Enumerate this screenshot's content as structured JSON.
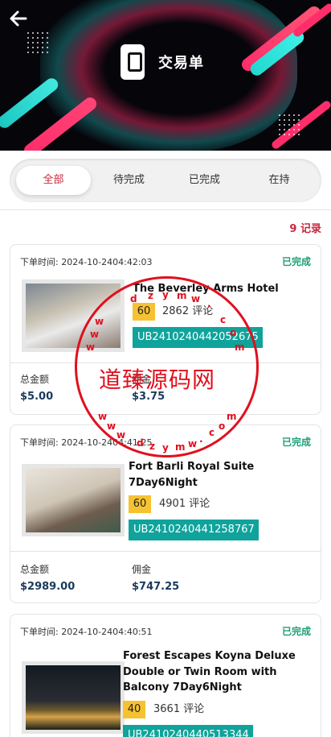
{
  "header": {
    "title": "交易单",
    "back_icon": "arrow-left-icon",
    "title_icon": "phone-icon"
  },
  "tabs": [
    {
      "label": "全部",
      "active": true
    },
    {
      "label": "待完成",
      "active": false
    },
    {
      "label": "已完成",
      "active": false
    },
    {
      "label": "在持",
      "active": false
    }
  ],
  "count_label": "9 记录",
  "orders": [
    {
      "time": "下单时间: 2024-10-2404:42:03",
      "status": "已完成",
      "name_line1": "The Beverley Arms Hotel",
      "name_line2": "",
      "name_line3": "",
      "rating": "60",
      "reviews": "2862 评论",
      "code": "UB2410240442052675",
      "total_label": "总金额",
      "total": "$5.00",
      "commission_label": "佣金",
      "commission": "$3.75"
    },
    {
      "time": "下单时间: 2024-10-2404:41:25",
      "status": "已完成",
      "name_line1": "Fort Barli Royal Suite",
      "name_line2": "7Day6Night",
      "name_line3": "",
      "rating": "60",
      "reviews": "4901 评论",
      "code": "UB2410240441258767",
      "total_label": "总金额",
      "total": "$2989.00",
      "commission_label": "佣金",
      "commission": "$747.25"
    },
    {
      "time": "下单时间: 2024-10-2404:40:51",
      "status": "已完成",
      "name_line1": "Forest Escapes Koyna Deluxe",
      "name_line2": "Double or Twin Room with",
      "name_line3": "Balcony 7Day6Night",
      "rating": "40",
      "reviews": "3661 评论",
      "code": "UB2410240440513344"
    }
  ],
  "watermark": {
    "text": "道臻源码网",
    "letters": [
      "d",
      "z",
      "y",
      "m",
      "w",
      ".",
      "c",
      "o",
      "m",
      "w",
      "w",
      "w",
      "w",
      "w",
      "w",
      "d",
      "z",
      "y",
      "m",
      "w",
      ".",
      "c",
      "o",
      "m"
    ]
  },
  "colors": {
    "accent": "#c5283d",
    "status_green": "#1f9f77",
    "code_bg": "#0fa39b",
    "rating_bg": "#f6c231",
    "amount": "#1a3a5c"
  }
}
